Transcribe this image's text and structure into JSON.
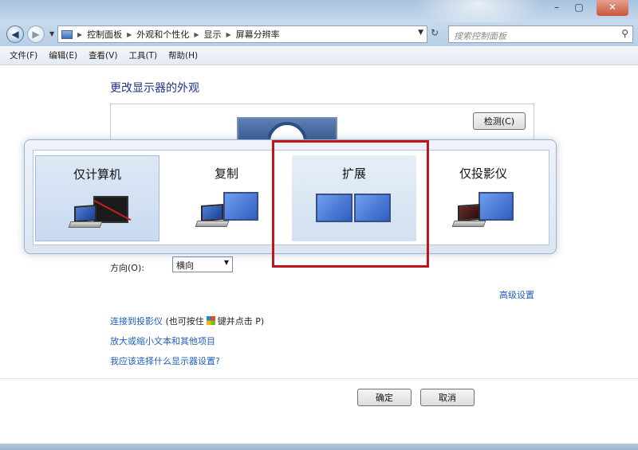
{
  "window": {
    "controls": [
      "–",
      "▢",
      "✕"
    ]
  },
  "address_bar": {
    "crumbs": [
      "控制面板",
      "外观和个性化",
      "显示",
      "屏幕分辨率"
    ],
    "search_placeholder": "搜索控制面板"
  },
  "menu": [
    "文件(F)",
    "编辑(E)",
    "查看(V)",
    "工具(T)",
    "帮助(H)"
  ],
  "content": {
    "heading": "更改显示器的外观",
    "detect_button": "检测(C)",
    "orientation_label": "方向(O):",
    "orientation_value": "横向",
    "advanced_link": "高级设置",
    "links": {
      "projector": "连接到投影仪",
      "projector_note_prefix": "(也可按住",
      "projector_note_suffix": "键并点击 P)",
      "text_size": "放大或缩小文本和其他项目",
      "which_settings": "我应该选择什么显示器设置?"
    },
    "ok_button": "确定",
    "cancel_button": "取消"
  },
  "projection_options": [
    {
      "label": "仅计算机",
      "state": "selected"
    },
    {
      "label": "复制",
      "state": "normal"
    },
    {
      "label": "扩展",
      "state": "hover"
    },
    {
      "label": "仅投影仪",
      "state": "normal"
    }
  ],
  "colors": {
    "highlight_box": "#c0141b",
    "link": "#1f5fbf",
    "heading": "#1e3287"
  }
}
